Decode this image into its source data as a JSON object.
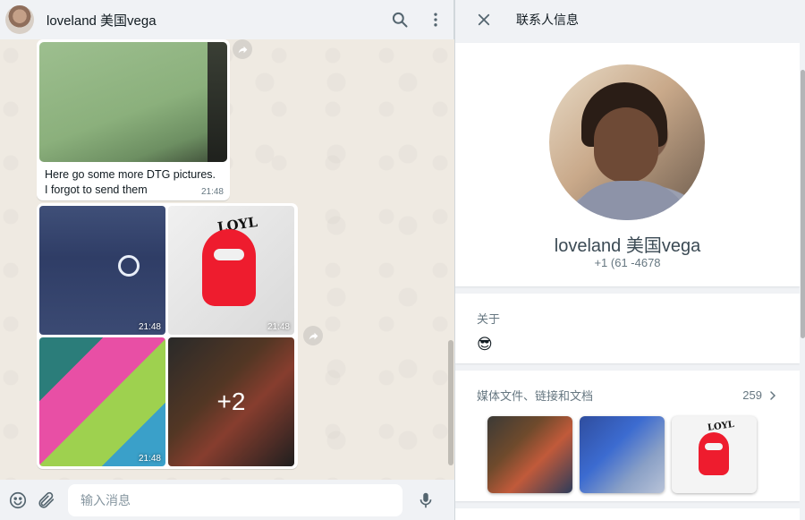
{
  "chat": {
    "contact_name": "loveland 美国vega",
    "messages": [
      {
        "caption": "Here go some more DTG pictures. I forgot to send them",
        "time": "21:48"
      }
    ],
    "album": {
      "times": [
        "21:48",
        "21:48",
        "21:48"
      ],
      "more_label": "+2",
      "tile_text": "LOYL"
    },
    "input_placeholder": "输入消息"
  },
  "contact_info": {
    "title": "联系人信息",
    "name": "loveland 美国vega",
    "phone": "+1 (61    -4678",
    "about_label": "关于",
    "about_value": "😎",
    "media_label": "媒体文件、链接和文档",
    "media_count": "259",
    "thumb_text": "LOYL"
  },
  "icons": {
    "search": "search-icon",
    "menu": "kebab-menu-icon",
    "close": "close-icon",
    "emoji": "emoji-icon",
    "attach": "paperclip-icon",
    "mic": "microphone-icon",
    "forward": "forward-icon",
    "chevron": "chevron-right-icon"
  },
  "colors": {
    "header_bg": "#f0f2f5",
    "chat_bg": "#efeae2",
    "bubble_bg": "#ffffff",
    "text_primary": "#111b21",
    "text_secondary": "#667781",
    "accent_red": "#ee1c2e"
  }
}
